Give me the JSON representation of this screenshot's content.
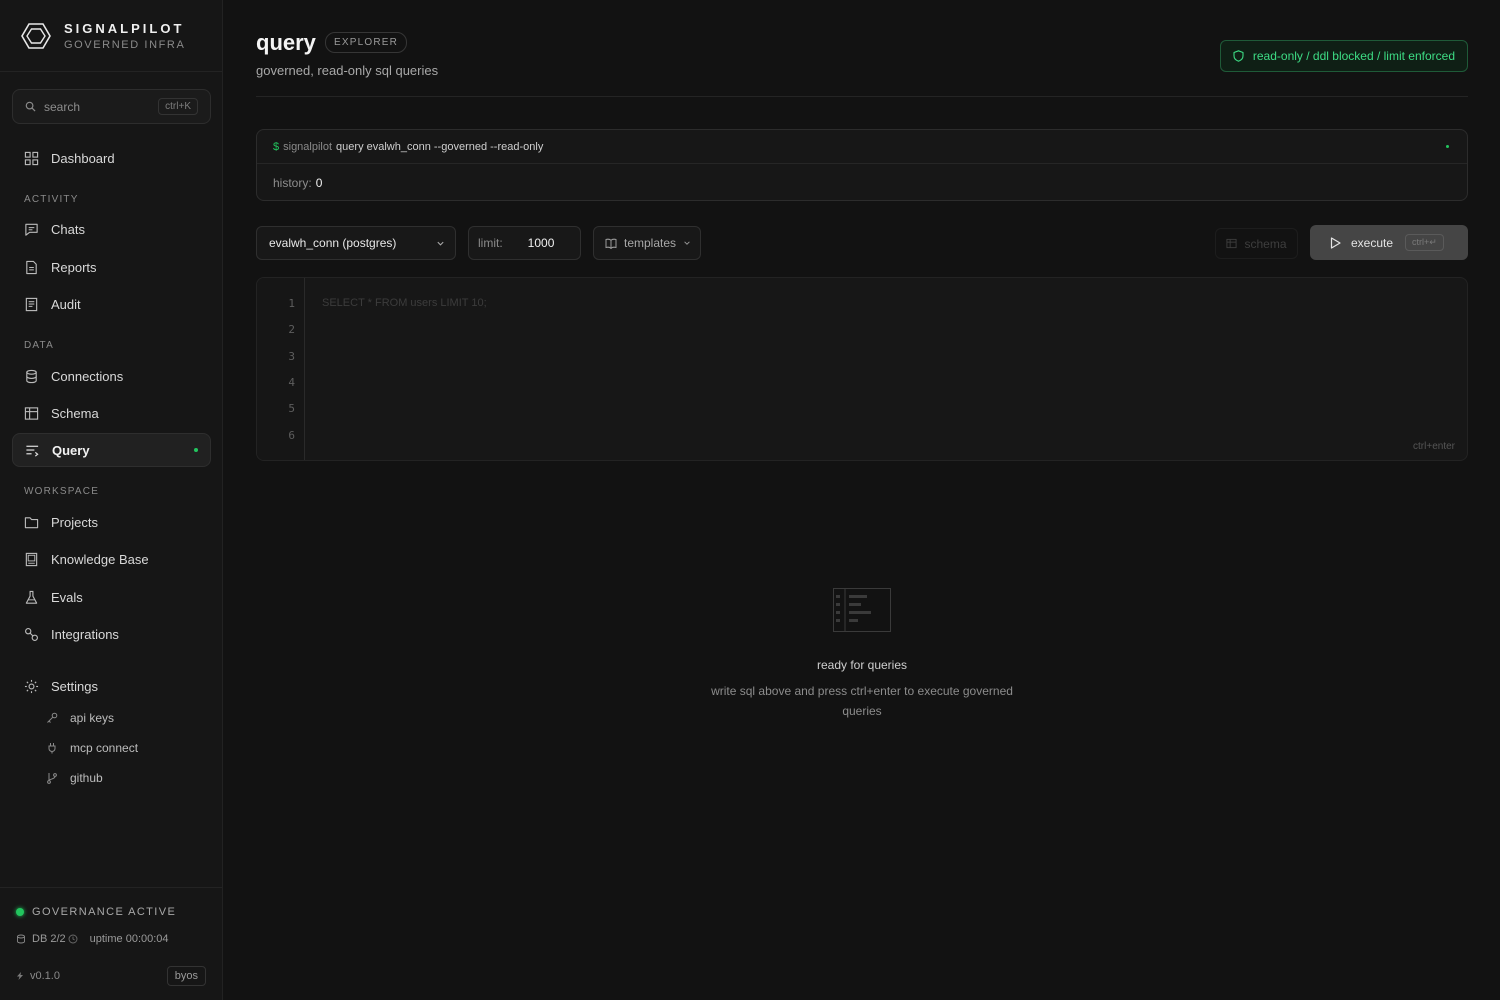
{
  "brand": {
    "name": "SIGNALPILOT",
    "subtitle": "GOVERNED INFRA"
  },
  "search": {
    "placeholder": "search",
    "shortcut": "ctrl+K"
  },
  "nav": {
    "dashboard": "Dashboard",
    "section_activity": "ACTIVITY",
    "chats": "Chats",
    "reports": "Reports",
    "audit": "Audit",
    "section_data": "DATA",
    "connections": "Connections",
    "schema": "Schema",
    "query": "Query",
    "section_workspace": "WORKSPACE",
    "projects": "Projects",
    "knowledge_base": "Knowledge Base",
    "evals": "Evals",
    "integrations": "Integrations",
    "settings": "Settings",
    "settings_items": [
      "api keys",
      "mcp connect",
      "github"
    ]
  },
  "footer": {
    "governance": "GOVERNANCE ACTIVE",
    "db": "DB 2/2",
    "uptime": "uptime 00:00:04",
    "version": "v0.1.0",
    "mode": "byos"
  },
  "page": {
    "title": "query",
    "badge": "EXPLORER",
    "subtitle": "governed, read-only sql queries",
    "guard": "read-only / ddl blocked / limit enforced"
  },
  "terminal": {
    "prompt": "$",
    "cli": "signalpilot",
    "command": "query evalwh_conn --governed --read-only",
    "history_label": "history:",
    "history_count": "0"
  },
  "toolbar": {
    "connection": "evalwh_conn (postgres)",
    "limit_label": "limit:",
    "limit_value": "1000",
    "templates": "templates",
    "schema": "schema",
    "execute": "execute",
    "execute_shortcut": "ctrl+↵"
  },
  "editor": {
    "line_numbers": [
      "1",
      "2",
      "3",
      "4",
      "5",
      "6"
    ],
    "placeholder": "SELECT * FROM users LIMIT 10;",
    "hint": "ctrl+enter"
  },
  "empty_state": {
    "title": "ready for queries",
    "description": "write sql above and press ctrl+enter to execute governed queries"
  },
  "colors": {
    "accent": "#22c55e",
    "background": "#121212",
    "sidebar": "#161616"
  }
}
